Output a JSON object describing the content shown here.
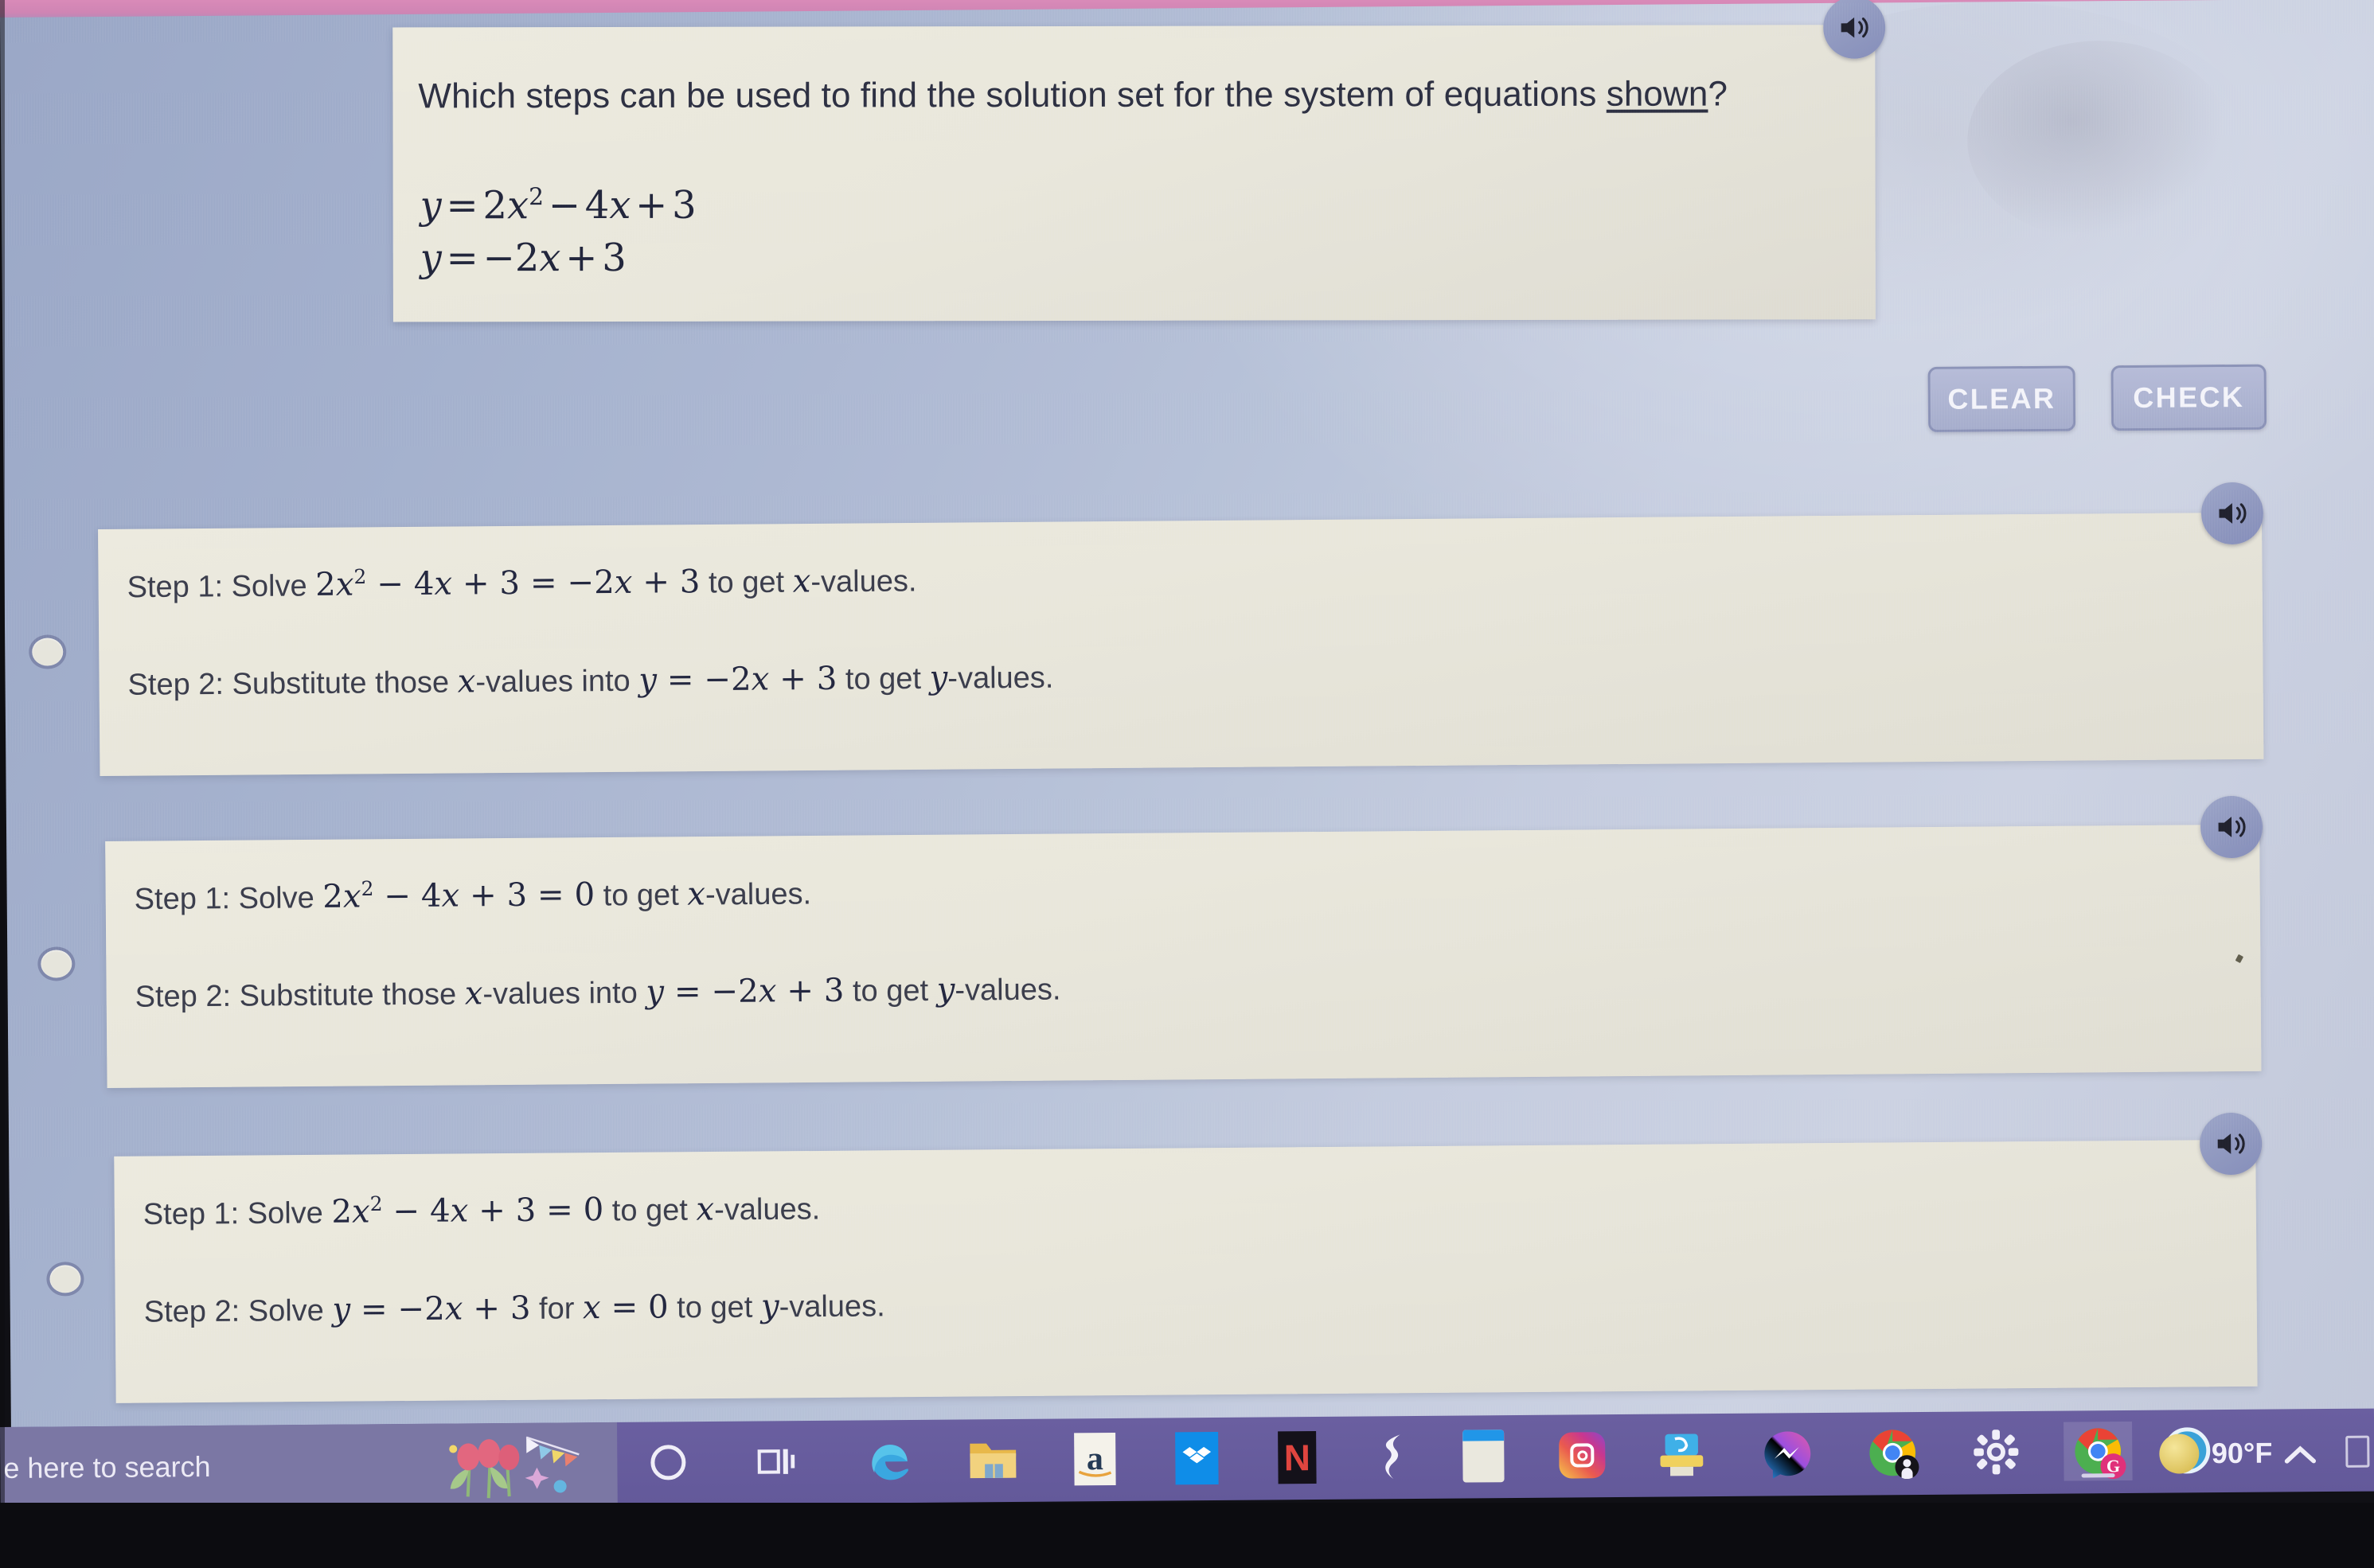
{
  "question": {
    "prompt_pre": "Which steps can be used to find the solution set for the system of equations ",
    "prompt_underlined": "shown",
    "prompt_post": "?",
    "equations": [
      {
        "lhs": "y",
        "rel": "=",
        "rhs_a": "2",
        "rhs_var": "x",
        "rhs_exp": "2",
        "rhs_b": "− 4",
        "rhs_var2": "x",
        "rhs_c": "+ 3"
      },
      {
        "lhs": "y",
        "rel": "=",
        "rhs_a": "−2",
        "rhs_var": "x",
        "rhs_c": "+ 3"
      }
    ],
    "equation_1_text": "y = 2x² − 4x + 3",
    "equation_2_text": "y = −2x + 3"
  },
  "toolbar": {
    "clear_label": "CLEAR",
    "check_label": "CHECK"
  },
  "speaker_icons": {
    "question_speaker": "speaker-icon",
    "option_speaker": "speaker-icon"
  },
  "options": [
    {
      "id": "option-a",
      "selected": false,
      "step1_prefix": "Step 1: Solve ",
      "step1_math": "2x² − 4x + 3 = −2x + 3",
      "step1_suffix_pre": " to get ",
      "step1_suffix_var": "x",
      "step1_suffix_post": "-values.",
      "step2_prefix": "Step 2: Substitute those ",
      "step2_var1": "x",
      "step2_mid": "-values into ",
      "step2_math": "y = −2x + 3",
      "step2_suffix_pre": " to get ",
      "step2_var2": "y",
      "step2_suffix_post": "-values."
    },
    {
      "id": "option-b",
      "selected": false,
      "step1_prefix": "Step 1: Solve ",
      "step1_math": "2x² − 4x + 3 = 0",
      "step1_suffix_pre": " to get ",
      "step1_suffix_var": "x",
      "step1_suffix_post": "-values.",
      "step2_prefix": "Step 2: Substitute those ",
      "step2_var1": "x",
      "step2_mid": "-values into ",
      "step2_math": "y = −2x + 3",
      "step2_suffix_pre": " to get ",
      "step2_var2": "y",
      "step2_suffix_post": "-values."
    },
    {
      "id": "option-c",
      "selected": false,
      "step1_prefix": "Step 1: Solve ",
      "step1_math": "2x² − 4x + 3 = 0",
      "step1_suffix_pre": " to get ",
      "step1_suffix_var": "x",
      "step1_suffix_post": "-values.",
      "step2_prefix": "Step 2: Solve ",
      "step2_var1": "",
      "step2_mid": "",
      "step2_math": "y = −2x + 3",
      "step2_suffix_pre": " for ",
      "step2_math_b": "x = 0",
      "step2_tail_pre": " to get ",
      "step2_var2": "y",
      "step2_suffix_post": "-values."
    }
  ],
  "taskbar": {
    "search_placeholder": "e here to search",
    "weather_temp": "90°F",
    "tray_chevron": "^",
    "icons": [
      {
        "name": "cortana-icon",
        "glyph": "O"
      },
      {
        "name": "task-view-icon",
        "glyph": ""
      },
      {
        "name": "microsoft-edge-icon",
        "glyph": ""
      },
      {
        "name": "file-explorer-icon",
        "glyph": ""
      },
      {
        "name": "amazon-icon",
        "glyph": "a"
      },
      {
        "name": "dropbox-icon",
        "glyph": ""
      },
      {
        "name": "netflix-icon",
        "glyph": "N"
      },
      {
        "name": "lightning-s-icon",
        "glyph": "S"
      },
      {
        "name": "document-window-icon",
        "glyph": ""
      },
      {
        "name": "instagram-icon",
        "glyph": ""
      },
      {
        "name": "printer-scanner-icon",
        "glyph": ""
      },
      {
        "name": "messenger-icon",
        "glyph": ""
      },
      {
        "name": "chrome-profile-icon",
        "glyph": ""
      },
      {
        "name": "settings-gear-icon",
        "glyph": ""
      },
      {
        "name": "chrome-google-icon",
        "glyph": "G"
      },
      {
        "name": "help-question-icon",
        "glyph": "?"
      }
    ]
  },
  "colors": {
    "screen_bg": "#b3bed6",
    "card_bg": "#e9e7dc",
    "button_bg": "#a7aecd",
    "taskbar_bg": "#63599a",
    "top_strip": "#cf85b4",
    "text_dark": "#3b3e4c",
    "math_text": "#232740"
  }
}
